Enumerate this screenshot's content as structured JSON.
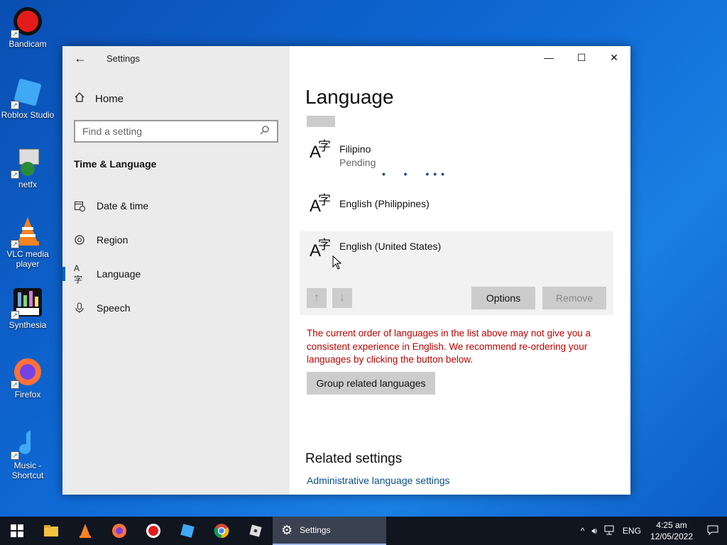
{
  "desktop": {
    "icons": [
      {
        "label": "Bandicam"
      },
      {
        "label": "Roblox Studio"
      },
      {
        "label": "netfx"
      },
      {
        "label": "VLC media player"
      },
      {
        "label": "Synthesia"
      },
      {
        "label": "Firefox"
      },
      {
        "label": "Music - Shortcut"
      }
    ]
  },
  "window": {
    "title": "Settings",
    "controls": {
      "minimize": "—",
      "maximize": "☐",
      "close": "✕"
    }
  },
  "sidebar": {
    "home_label": "Home",
    "search_placeholder": "Find a setting",
    "section_title": "Time & Language",
    "items": [
      {
        "label": "Date & time",
        "icon": "calendar-clock-icon"
      },
      {
        "label": "Region",
        "icon": "globe-icon"
      },
      {
        "label": "Language",
        "icon": "language-icon",
        "active": true
      },
      {
        "label": "Speech",
        "icon": "microphone-icon"
      }
    ]
  },
  "content": {
    "page_title": "Language",
    "languages": [
      {
        "name": "Filipino",
        "status": "Pending"
      },
      {
        "name": "English (Philippines)",
        "status": ""
      },
      {
        "name": "English (United States)",
        "status": "",
        "selected": true
      }
    ],
    "options_button": "Options",
    "remove_button": "Remove",
    "warning_text": "The current order of languages in the list above may not give you a consistent experience in English. We recommend re-ordering your languages by clicking the button below.",
    "group_button": "Group related languages",
    "related_title": "Related settings",
    "admin_link": "Administrative language settings"
  },
  "taskbar": {
    "active_app": "Settings",
    "tray_lang": "ENG",
    "time": "4:25 am",
    "date": "12/05/2022"
  },
  "colors": {
    "accent": "#0067b8",
    "warning": "#c00000",
    "link": "#0a4f8a"
  }
}
